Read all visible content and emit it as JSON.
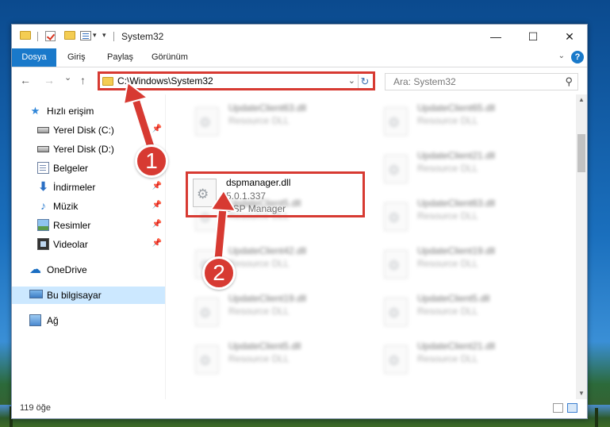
{
  "window": {
    "title": "System32",
    "minimize": "—",
    "maximize": "☐",
    "close": "✕"
  },
  "ribbon": {
    "tabs": [
      "Dosya",
      "Giriş",
      "Paylaş",
      "Görünüm"
    ],
    "help": "?"
  },
  "nav": {
    "back": "←",
    "forward": "→",
    "recent": "⌄",
    "up": "↑",
    "address": "C:\\Windows\\System32",
    "search_placeholder": "Ara: System32"
  },
  "sidebar": {
    "items": [
      {
        "label": "Hızlı erişim",
        "icon": "star-icon",
        "pinned": false
      },
      {
        "label": "Yerel Disk (C:)",
        "icon": "disk-icon",
        "pinned": true
      },
      {
        "label": "Yerel Disk (D:)",
        "icon": "disk-icon",
        "pinned": false
      },
      {
        "label": "Belgeler",
        "icon": "document-icon",
        "pinned": true
      },
      {
        "label": "İndirmeler",
        "icon": "download-icon",
        "pinned": true
      },
      {
        "label": "Müzik",
        "icon": "music-icon",
        "pinned": true
      },
      {
        "label": "Resimler",
        "icon": "pictures-icon",
        "pinned": true
      },
      {
        "label": "Videolar",
        "icon": "video-icon",
        "pinned": true
      },
      {
        "label": "OneDrive",
        "icon": "cloud-icon",
        "pinned": false
      },
      {
        "label": "Bu bilgisayar",
        "icon": "computer-icon",
        "pinned": false,
        "selected": true
      },
      {
        "label": "Ağ",
        "icon": "network-icon",
        "pinned": false
      }
    ]
  },
  "files": {
    "left": [
      {
        "name": "UpdateClient63.dll",
        "type": "Resource DLL"
      },
      {
        "name": "UpdateClient5.dll",
        "type": "Resource DLL"
      },
      {
        "name": "UpdateClient42.dll",
        "type": "Resource DLL"
      },
      {
        "name": "UpdateClient19.dll",
        "type": "Resource DLL"
      },
      {
        "name": "UpdateClient5.dll",
        "type": "Resource DLL"
      }
    ],
    "right": [
      {
        "name": "UpdateClient65.dll",
        "type": "Resource DLL"
      },
      {
        "name": "UpdateClient21.dll",
        "type": "Resource DLL"
      },
      {
        "name": "UpdateClient63.dll",
        "type": "Resource DLL"
      },
      {
        "name": "UpdateClient19.dll",
        "type": "Resource DLL"
      },
      {
        "name": "UpdateClient5.dll",
        "type": "Resource DLL"
      },
      {
        "name": "UpdateClient21.dll",
        "type": "Resource DLL"
      }
    ],
    "highlighted": {
      "name": "dspmanager.dll",
      "version": "5.0.1.337",
      "description": "DSP Manager"
    }
  },
  "status": {
    "item_count": "119 öğe"
  },
  "annotations": {
    "badge1": "1",
    "badge2": "2",
    "color": "#d73a32"
  }
}
